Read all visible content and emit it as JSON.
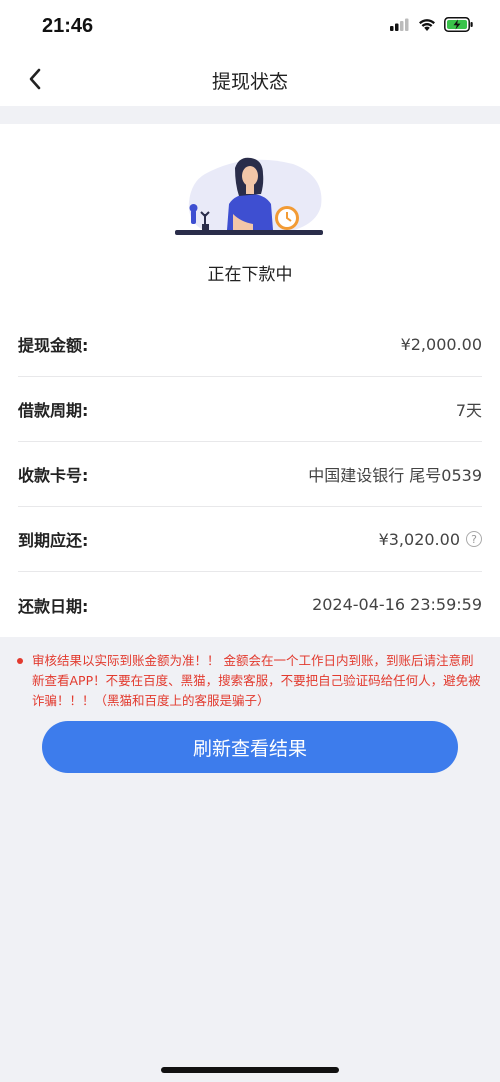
{
  "status_bar": {
    "time": "21:46"
  },
  "nav": {
    "title": "提现状态",
    "back_icon": "chevron-left-icon"
  },
  "hero": {
    "status_text": "正在下款中"
  },
  "details": [
    {
      "label": "提现金额:",
      "value": "¥2,000.00"
    },
    {
      "label": "借款周期:",
      "value": "7天"
    },
    {
      "label": "收款卡号:",
      "value": "中国建设银行 尾号0539"
    },
    {
      "label": "到期应还:",
      "value": "¥3,020.00",
      "help": "?"
    },
    {
      "label": "还款日期:",
      "value": "2024-04-16 23:59:59"
    }
  ],
  "notice": "审核结果以实际到账金额为准！！ 金额会在一个工作日内到账，到账后请注意刷新查看APP！不要在百度、黑猫，搜索客服，不要把自己验证码给任何人，避免被诈骗！！！（黑猫和百度上的客服是骗子）",
  "button": {
    "label": "刷新查看结果"
  },
  "colors": {
    "accent": "#3d7cec",
    "warning": "#e23a2e",
    "background": "#f0f1f5"
  }
}
